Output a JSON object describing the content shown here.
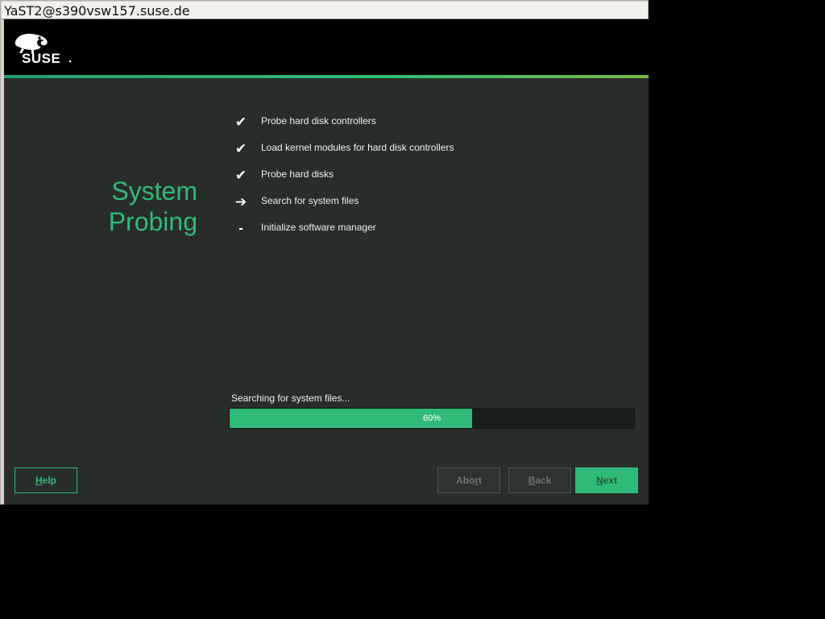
{
  "window": {
    "title": "YaST2@s390vsw157.suse.de"
  },
  "banner": {
    "logo_text": "SUSE"
  },
  "page": {
    "heading_line1": "System",
    "heading_line2": "Probing"
  },
  "steps": [
    {
      "status": "done",
      "icon": "checkmark-icon",
      "glyph": "✔",
      "label": "Probe hard disk controllers"
    },
    {
      "status": "done",
      "icon": "checkmark-icon",
      "glyph": "✔",
      "label": "Load kernel modules for hard disk controllers"
    },
    {
      "status": "done",
      "icon": "checkmark-icon",
      "glyph": "✔",
      "label": "Probe hard disks"
    },
    {
      "status": "current",
      "icon": "arrow-right-icon",
      "glyph": "➔",
      "label": "Search for system files"
    },
    {
      "status": "pending",
      "icon": "dash-icon",
      "glyph": "-",
      "label": "Initialize software manager"
    }
  ],
  "progress": {
    "label": "Searching for system files...",
    "percent": 60,
    "percent_text": "60%"
  },
  "buttons": {
    "help": {
      "label": "Help",
      "mnemonic": "H",
      "enabled": true
    },
    "abort": {
      "label": "Abort",
      "mnemonic": "r",
      "enabled": false
    },
    "back": {
      "label": "Back",
      "mnemonic": "B",
      "enabled": false
    },
    "next": {
      "label": "Next",
      "mnemonic": "N",
      "enabled": false
    }
  },
  "colors": {
    "accent": "#30ba78",
    "background": "#282d29",
    "banner": "#000000"
  }
}
